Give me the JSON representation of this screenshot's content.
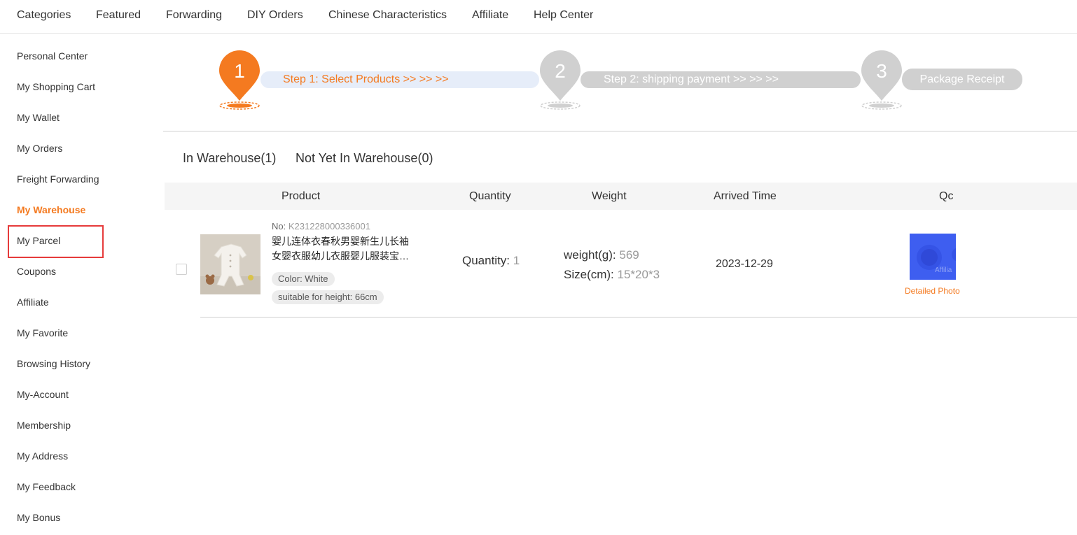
{
  "topnav": {
    "items": [
      "Categories",
      "Featured",
      "Forwarding",
      "DIY Orders",
      "Chinese Characteristics",
      "Affiliate",
      "Help Center"
    ]
  },
  "sidebar": {
    "items": [
      "Personal Center",
      "My Shopping Cart",
      "My Wallet",
      "My Orders",
      "Freight Forwarding",
      "My Warehouse",
      "My Parcel",
      "Coupons",
      "Affiliate",
      "My Favorite",
      "Browsing History",
      "My-Account",
      "Membership",
      "My Address",
      "My Feedback",
      "My Bonus"
    ],
    "active": "My Warehouse"
  },
  "steps": {
    "step1_num": "1",
    "step1_label": "Step 1: Select Products >> >> >>",
    "step2_num": "2",
    "step2_label": "Step 2: shipping payment >> >> >>",
    "step3_num": "3",
    "step3_label": "Package Receipt"
  },
  "tabs": {
    "in_warehouse": "In Warehouse(1)",
    "not_in_warehouse": "Not Yet In Warehouse(0)"
  },
  "table": {
    "headers": {
      "product": "Product",
      "quantity": "Quantity",
      "weight": "Weight",
      "arrived": "Arrived Time",
      "qc": "Qc"
    },
    "rows": [
      {
        "no_label": "No:",
        "no_value": "K231228000336001",
        "name_line1": "婴儿连体衣春秋男婴新生儿长袖",
        "name_line2": "女婴衣服幼儿衣服婴儿服装宝宝连体衣",
        "tag_color": "Color: White",
        "tag_height": "suitable for height: 66cm",
        "quantity_label": "Quantity:",
        "quantity_value": "1",
        "weight_label": "weight(g):",
        "weight_value": "569",
        "size_label": "Size(cm):",
        "size_value": "15*20*3",
        "arrived_time": "2023-12-29",
        "qc_image_text": "Affilia",
        "qc_link": "Detailed Photo"
      }
    ]
  },
  "colors": {
    "accent": "#f47a20",
    "inactive_step": "#d0d0d0",
    "active_step_bar": "#e6edf9",
    "highlight_box": "#e63b3b",
    "qc_bg": "#3e5ef0"
  }
}
